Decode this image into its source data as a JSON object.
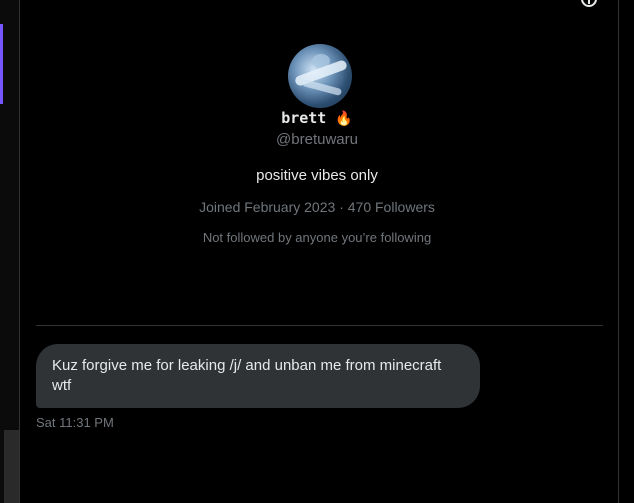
{
  "profile": {
    "display_name": "brett",
    "name_emoji": "🔥",
    "handle": "@bretuwaru",
    "bio": "positive vibes only",
    "joined": "Joined February 2023",
    "separator": "·",
    "followers": "470 Followers",
    "mutuals_note": "Not followed by anyone you’re following"
  },
  "messages": [
    {
      "text": "Kuz forgive me for leaking /j/ and unban me from minecraft wtf",
      "timestamp": "Sat 11:31 PM"
    }
  ],
  "icons": {
    "top_right": "info-icon",
    "avatar": "avatar-image"
  },
  "colors": {
    "background": "#000000",
    "text_primary": "#e7e9ea",
    "text_secondary": "#71767b",
    "bubble": "#2f3336",
    "accent": "#7856ff"
  }
}
